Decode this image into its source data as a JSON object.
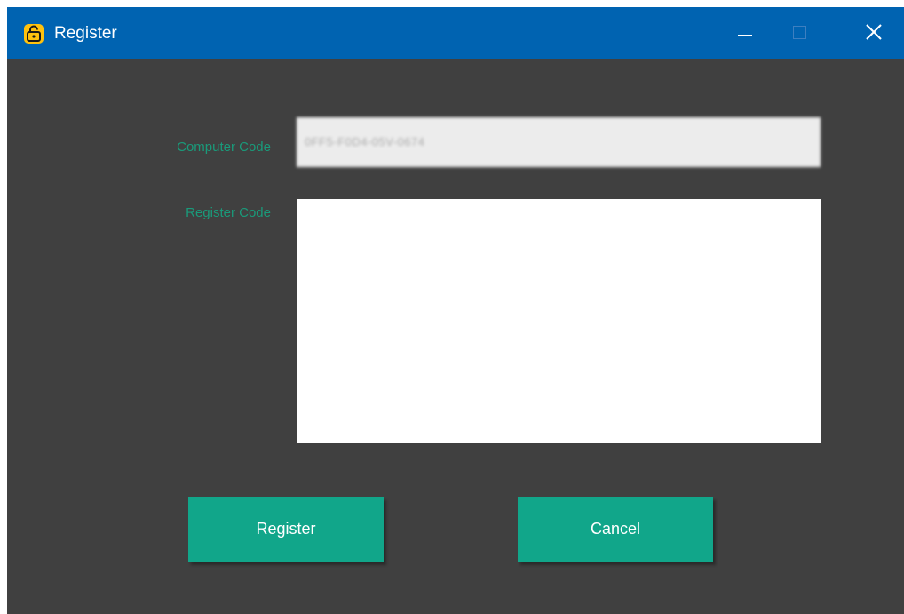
{
  "window": {
    "title": "Register",
    "app_icon": "unlock-icon",
    "titlebar_color": "#0063b1",
    "background_color": "#404040",
    "controls": {
      "minimize_icon": "minimize-icon",
      "maximize_icon": "maximize-icon",
      "close_icon": "close-icon"
    }
  },
  "form": {
    "label_color": "#1a9a7a",
    "computer_code": {
      "label": "Computer Code",
      "value": "0FF5-F0D4-05V-0674"
    },
    "register_code": {
      "label": "Register Code",
      "value": ""
    }
  },
  "buttons": {
    "color": "#11a68a",
    "register_label": "Register",
    "cancel_label": "Cancel"
  }
}
